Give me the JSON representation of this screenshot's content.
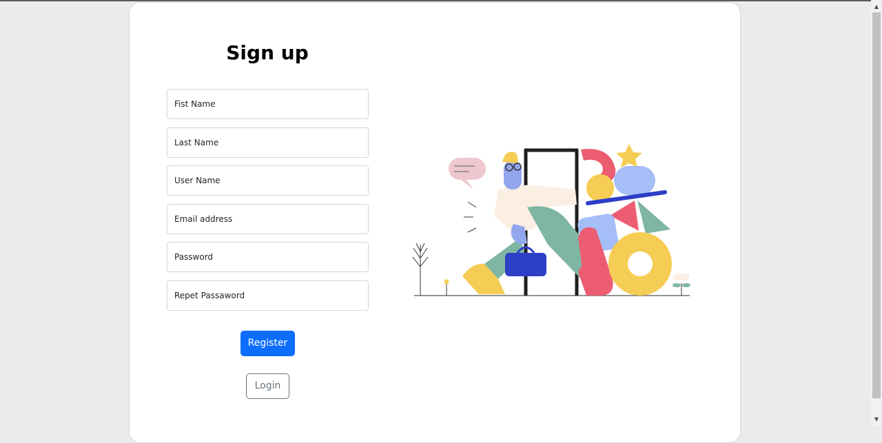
{
  "page": {
    "title": "Sign up"
  },
  "form": {
    "first_name_placeholder": "Fist Name",
    "last_name_placeholder": "Last Name",
    "user_name_placeholder": "User Name",
    "email_placeholder": "Email address",
    "password_placeholder": "Password",
    "repeat_password_placeholder": "Repet Passaword",
    "register_label": "Register",
    "login_label": "Login"
  },
  "colors": {
    "primary": "#0d6efd",
    "secondary": "#6c757d",
    "page_background": "#ebebeb",
    "card_background": "#ffffff"
  },
  "icons": {
    "scroll_up": "scroll-up-arrow-icon",
    "scroll_down": "scroll-down-arrow-icon"
  }
}
